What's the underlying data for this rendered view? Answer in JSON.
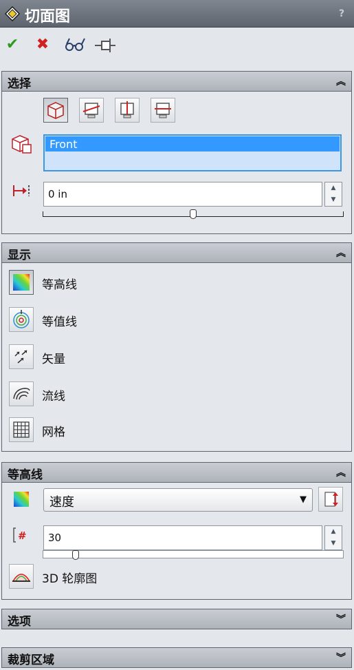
{
  "title": "切面图",
  "help": "?",
  "sections": {
    "selection": {
      "title": "选择",
      "toggle": "⌃",
      "face_value": "Front",
      "offset_value": "0 in",
      "offset_level": 0.5
    },
    "display": {
      "title": "显示",
      "toggle": "⌃",
      "items": [
        {
          "label": "等高线",
          "icon": "contour-icon"
        },
        {
          "label": "等值线",
          "icon": "isoline-icon"
        },
        {
          "label": "矢量",
          "icon": "vector-icon"
        },
        {
          "label": "流线",
          "icon": "streamline-icon"
        },
        {
          "label": "网格",
          "icon": "mesh-icon"
        }
      ]
    },
    "contours": {
      "title": "等高线",
      "toggle": "⌃",
      "parameter": "速度",
      "levels_value": "30",
      "levels_level": 0.11,
      "profile_label": "3D 轮廓图"
    },
    "options": {
      "title": "选项",
      "toggle": "⌄"
    },
    "crop": {
      "title": "裁剪区域",
      "toggle": "⌄"
    }
  },
  "colors": {
    "accent": "#3399ff",
    "header_dark": "#5d646d",
    "ok": "#2e9b1c",
    "cancel": "#d21f1f"
  }
}
